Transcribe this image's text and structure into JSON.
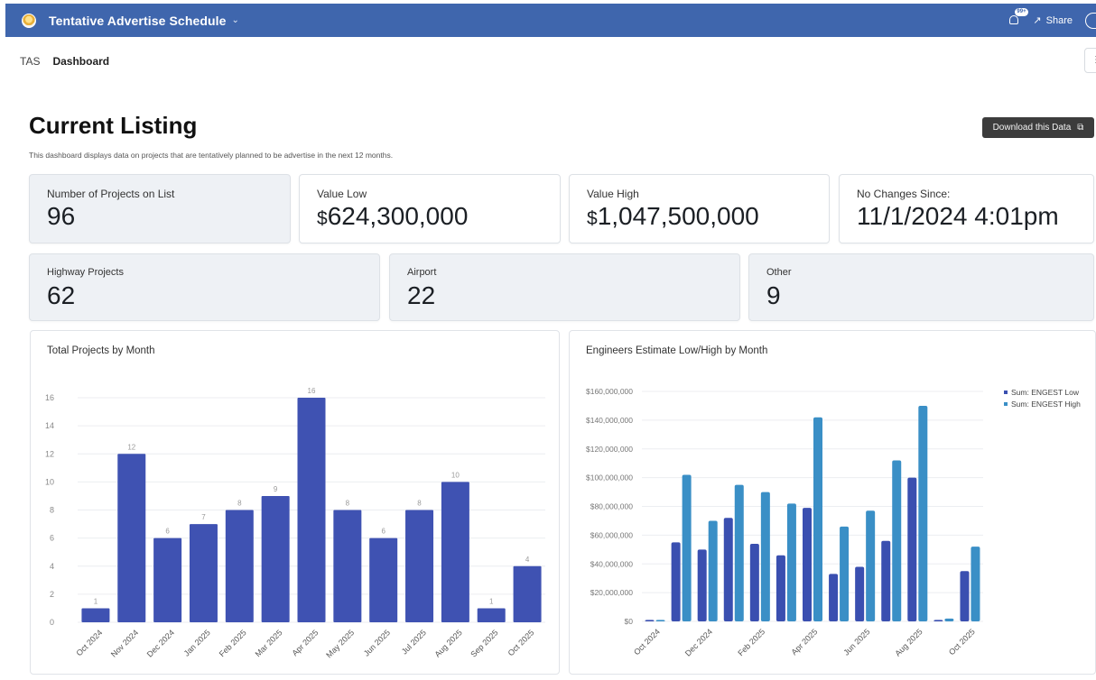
{
  "app": {
    "title": "Tentative Advertise Schedule",
    "notif_badge": "99+",
    "share_label": "Share",
    "brand_color": "#3f66ad"
  },
  "breadcrumb": {
    "root": "TAS",
    "current": "Dashboard"
  },
  "header": {
    "title": "Current Listing",
    "description": "This dashboard displays data on projects that are tentatively planned to be advertise in the next 12 months.",
    "download_label": "Download this Data"
  },
  "metrics": {
    "projects": {
      "label": "Number of Projects on List",
      "value": "96"
    },
    "value_low": {
      "label": "Value Low",
      "currency": "$",
      "value": "624,300,000"
    },
    "value_high": {
      "label": "Value High",
      "currency": "$",
      "value": "1,047,500,000"
    },
    "no_changes": {
      "label": "No Changes Since:",
      "value": "11/1/2024 4:01pm"
    },
    "highway": {
      "label": "Highway Projects",
      "value": "62"
    },
    "airport": {
      "label": "Airport",
      "value": "22"
    },
    "other": {
      "label": "Other",
      "value": "9"
    }
  },
  "chart_data": [
    {
      "type": "bar",
      "title": "Total Projects by Month",
      "categories": [
        "Oct 2024",
        "Nov 2024",
        "Dec 2024",
        "Jan 2025",
        "Feb 2025",
        "Mar 2025",
        "Apr 2025",
        "May 2025",
        "Jun 2025",
        "Jul 2025",
        "Aug 2025",
        "Sep 2025",
        "Oct 2025"
      ],
      "values": [
        1,
        12,
        6,
        7,
        8,
        9,
        16,
        8,
        6,
        8,
        10,
        1,
        4
      ],
      "ylim": [
        0,
        16
      ],
      "yticks": [
        0,
        2,
        4,
        6,
        8,
        10,
        12,
        14,
        16
      ],
      "data_labels": true,
      "grid": true,
      "color": "#3f52b2"
    },
    {
      "type": "bar",
      "title": "Engineers Estimate Low/High by Month",
      "categories": [
        "Oct 2024",
        "Nov 2024",
        "Dec 2024",
        "Jan 2025",
        "Feb 2025",
        "Mar 2025",
        "Apr 2025",
        "May 2025",
        "Jun 2025",
        "Jul 2025",
        "Aug 2025",
        "Sep 2025",
        "Oct 2025"
      ],
      "x_tick_labels": [
        "Oct 2024",
        "Dec 2024",
        "Feb 2025",
        "Apr 2025",
        "Jun 2025",
        "Aug 2025",
        "Oct 2025"
      ],
      "series": [
        {
          "name": "Sum: ENGEST Low",
          "color": "#3a4fb0",
          "values": [
            1000000,
            55000000,
            50000000,
            72000000,
            54000000,
            46000000,
            79000000,
            33000000,
            38000000,
            56000000,
            100000000,
            1000000,
            35000000
          ]
        },
        {
          "name": "Sum: ENGEST High",
          "color": "#3a8fc6",
          "values": [
            1000000,
            102000000,
            70000000,
            95000000,
            90000000,
            82000000,
            142000000,
            66000000,
            77000000,
            112000000,
            150000000,
            2000000,
            52000000
          ]
        }
      ],
      "ylim": [
        0,
        160000000
      ],
      "yticks": [
        "$0",
        "$20,000,000",
        "$40,000,000",
        "$60,000,000",
        "$80,000,000",
        "$100,000,000",
        "$120,000,000",
        "$140,000,000",
        "$160,000,000"
      ],
      "legend_position": "top-right",
      "grid": true
    }
  ]
}
